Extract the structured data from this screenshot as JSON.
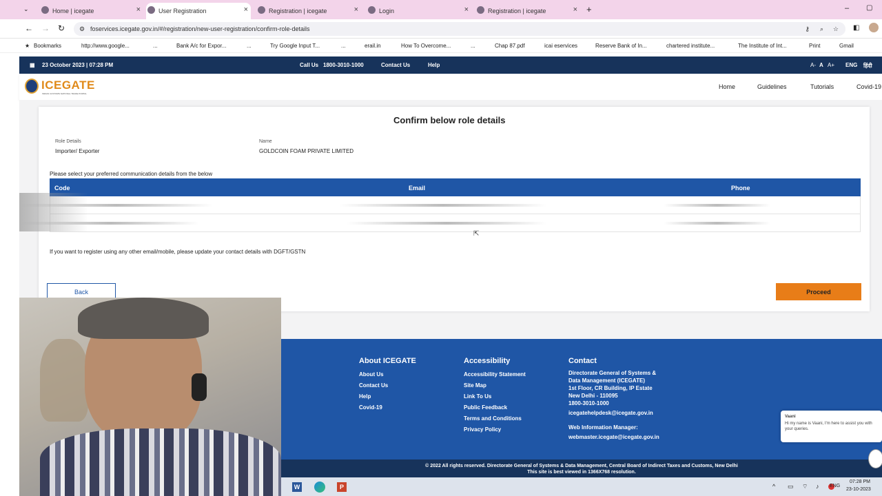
{
  "browser": {
    "tabs": [
      {
        "label": "Home | icegate"
      },
      {
        "label": "User Registration"
      },
      {
        "label": "Registration | icegate"
      },
      {
        "label": "Login"
      },
      {
        "label": "Registration | icegate"
      }
    ],
    "url": "foservices.icegate.gov.in/#/registration/new-user-registration/confirm-role-details",
    "bookmarks": [
      "Bookmarks",
      "http://www.google...",
      "...",
      "Bank A/c for Expor...",
      "...",
      "Try Google Input T...",
      "...",
      "erail.in",
      "How To Overcome...",
      "...",
      "Chap 87.pdf",
      "icai eservices",
      "Reserve Bank of In...",
      "chartered institute...",
      "The Institute of Int...",
      "Print",
      "Gmail"
    ]
  },
  "site": {
    "topbar": {
      "datetime": "23 October 2023 | 07:28 PM",
      "call_us_label": "Call Us",
      "call_us_number": "1800-3010-1000",
      "contact_us": "Contact Us",
      "help": "Help",
      "font_minus": "A-",
      "font_normal": "A",
      "font_plus": "A+",
      "lang_en": "ENG",
      "lang_hi": "हिंदी"
    },
    "logo_text": "ICEGATE",
    "logo_sub": "INDIAN CUSTOMS NATIONAL TRADE PORTAL",
    "nav": [
      "Home",
      "Guidelines",
      "Tutorials",
      "Covid-19"
    ]
  },
  "form": {
    "title": "Confirm below role details",
    "role_label": "Role Details",
    "role_value": "Importer/ Exporter",
    "name_label": "Name",
    "name_value": "GOLDCOIN FOAM PRIVATE LIMITED",
    "comm_instruction": "Please select your preferred communication details from the below",
    "columns": [
      "Code",
      "Email",
      "Phone"
    ],
    "note": "If you want to register using any other email/mobile, please update your contact details with DGFT/GSTN",
    "back_label": "Back",
    "proceed_label": "Proceed"
  },
  "footer": {
    "about_title": "About ICEGATE",
    "about_links": [
      "About Us",
      "Contact Us",
      "Help",
      "Covid-19"
    ],
    "access_title": "Accessibility",
    "access_links": [
      "Accessibility Statement",
      "Site Map",
      "Link To Us",
      "Public Feedback",
      "Terms and Conditions",
      "Privacy Policy"
    ],
    "contact_title": "Contact",
    "contact_lines": [
      "Directorate General of Systems &",
      "Data Management (ICEGATE)",
      "1st Floor, CR Building, IP Estate",
      "New Delhi - 110095",
      "1800-3010-1000"
    ],
    "contact_email": "icegatehelpdesk@icegate.gov.in",
    "web_manager_label": "Web Information Manager:",
    "web_manager_email": "webmaster.icegate@icegate.gov.in",
    "copyright": "© 2022 All rights reserved. Directorate General of Systems & Data Management, Central Board of Indirect Taxes and Customs, New Delhi",
    "resolution_note": "This site is best viewed in 1366X768 resolution."
  },
  "chat": {
    "name": "Vaani",
    "message": "Hi my name is Vaani, I'm here to assist you with your queries."
  },
  "taskbar": {
    "lang": "ENG",
    "time": "07:28 PM",
    "date": "23-10-2023"
  }
}
